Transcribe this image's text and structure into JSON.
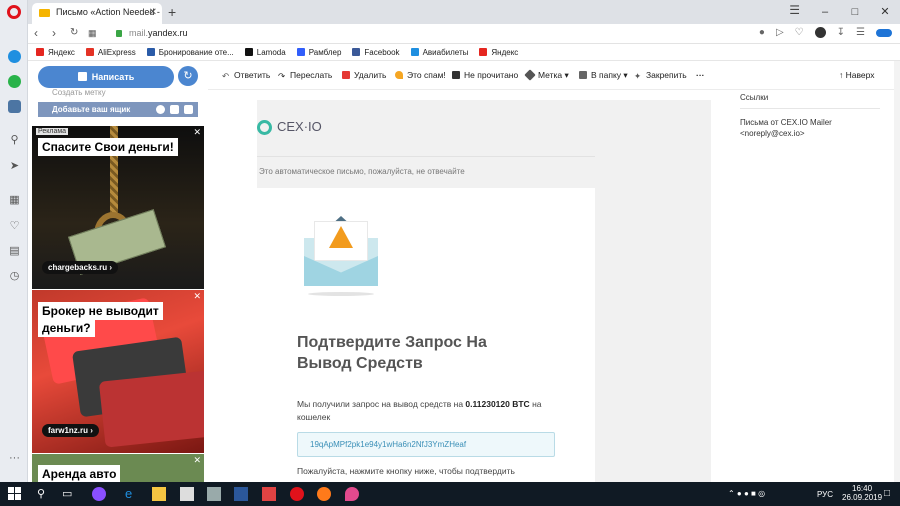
{
  "browser": {
    "tab_title": "Письмо «Action Needed -",
    "url_prefix": "mail.",
    "url_domain": "yandex.ru"
  },
  "bookmarks": [
    {
      "label": "Яндекс",
      "color": "#e52620"
    },
    {
      "label": "AliExpress",
      "color": "#e43225"
    },
    {
      "label": "Бронирование оте...",
      "color": "#2a5ba8"
    },
    {
      "label": "Lamoda",
      "color": "#111111"
    },
    {
      "label": "Рамблер",
      "color": "#315efb"
    },
    {
      "label": "Facebook",
      "color": "#3b5998"
    },
    {
      "label": "Авиабилеты",
      "color": "#1f8fe0"
    },
    {
      "label": "Яндекс",
      "color": "#e52620"
    }
  ],
  "mail_sidebar": {
    "compose_label": "Написать",
    "create_tag_label": "Создать метку",
    "add_box_label": "Добавьте ваш ящик"
  },
  "ads": {
    "ad_mark": "Реклама",
    "ad1_headline": "Спасите Свои деньги!",
    "ad1_link": "chargebacks.ru",
    "ad2_headline_line1": "Брокер не выводит",
    "ad2_headline_line2": "деньги?",
    "ad2_link": "farw1nz.ru",
    "ad3_headline": "Аренда авто"
  },
  "toolbar": {
    "reply": "Ответить",
    "forward": "Переслать",
    "delete": "Удалить",
    "spam": "Это спам!",
    "unread": "Не прочитано",
    "label": "Метка",
    "to_folder": "В папку",
    "pin": "Закрепить",
    "up": "Наверх"
  },
  "message": {
    "brand_logo": "CEX·IO",
    "auto_note": "Это автоматическое письмо, пожалуйста, не отвечайте",
    "title": "Подтвердите Запрос На Вывод Средств",
    "p1_before": "Мы получили запрос на вывод средств на ",
    "amount": "0.11230120 BTC",
    "p1_after": " на кошелек",
    "wallet": "19qApMPf2pk1e94y1wHa6n2NfJ3YmZHeaf",
    "p2": "Пожалуйста, нажмите кнопку ниже, чтобы подтвердить"
  },
  "right_sidebar": {
    "links_title": "Ссылки",
    "sender_line1": "Письма от CEX.IO Mailer",
    "sender_line2": "<noreply@cex.io>"
  },
  "taskbar": {
    "lang": "РУС",
    "time": "16:40",
    "date": "26.09.2019"
  }
}
